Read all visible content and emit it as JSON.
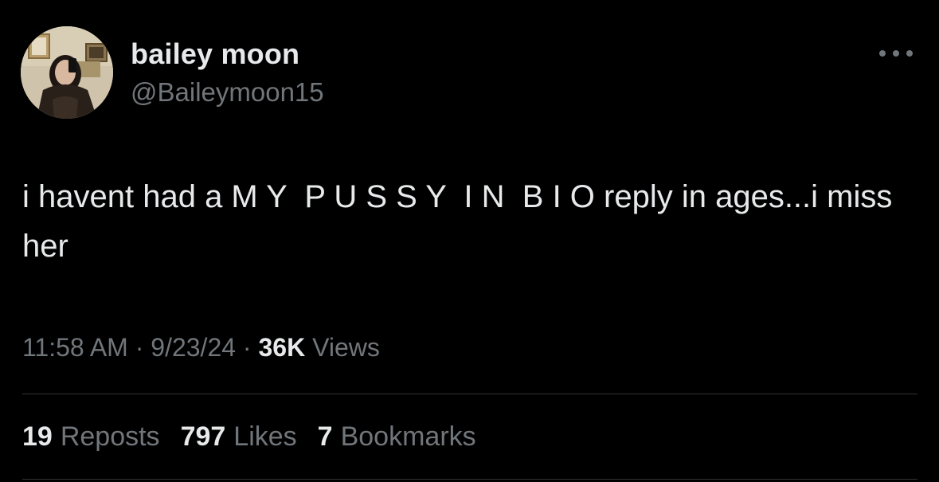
{
  "author": {
    "display_name": "bailey moon",
    "handle": "@Baileymoon15"
  },
  "tweet": {
    "text": "i havent had a M Y  P U S S Y  I N  B I O reply in ages...i miss her"
  },
  "meta": {
    "time": "11:58 AM",
    "separator1": " · ",
    "date": "9/23/24",
    "separator2": " · ",
    "views_count": "36K",
    "views_label": " Views"
  },
  "stats": {
    "reposts": {
      "count": "19",
      "label": "Reposts"
    },
    "likes": {
      "count": "797",
      "label": "Likes"
    },
    "bookmarks": {
      "count": "7",
      "label": "Bookmarks"
    }
  },
  "icons": {
    "more": "more-horizontal-icon"
  },
  "colors": {
    "background": "#000000",
    "primary_text": "#e7e9ea",
    "secondary_text": "#71767b",
    "divider": "#2f3336"
  }
}
